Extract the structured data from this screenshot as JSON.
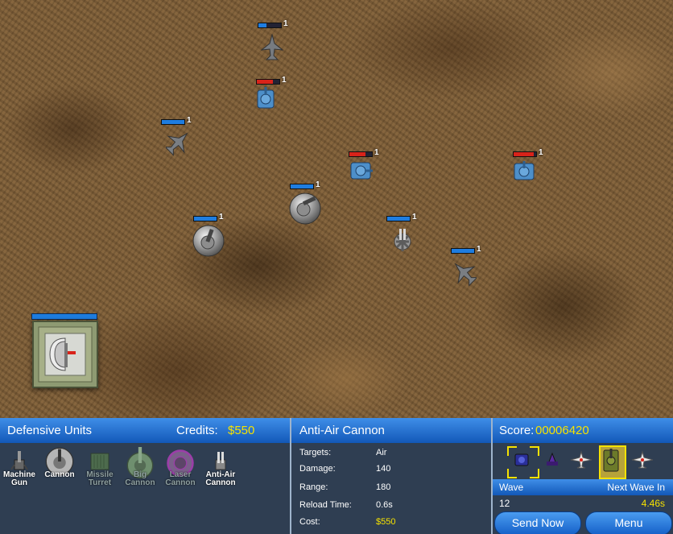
{
  "map": {
    "enemies": [
      {
        "kind": "jet",
        "hp_color": "blue",
        "hp": 0.35,
        "level": "1"
      },
      {
        "kind": "tank",
        "hp_color": "red",
        "hp": 0.7,
        "level": "1"
      },
      {
        "kind": "jet",
        "hp_color": "blue",
        "hp": 1.0,
        "level": "1"
      },
      {
        "kind": "tank",
        "hp_color": "red",
        "hp": 0.7,
        "level": "1"
      },
      {
        "kind": "tank",
        "hp_color": "red",
        "hp": 0.9,
        "level": "1"
      },
      {
        "kind": "jet",
        "hp_color": "blue",
        "hp": 1.0,
        "level": "1"
      }
    ],
    "towers": [
      {
        "kind": "cannon",
        "hp_color": "blue",
        "hp": 1.0,
        "level": "1"
      },
      {
        "kind": "cannon",
        "hp_color": "blue",
        "hp": 1.0,
        "level": "1"
      },
      {
        "kind": "anti-air",
        "hp_color": "blue",
        "hp": 1.0,
        "level": "1"
      }
    ],
    "base_hp": 1.0
  },
  "defensive_units": {
    "title": "Defensive Units",
    "credits_label": "Credits:",
    "credits_value": "$550",
    "units": [
      {
        "label": "Machine\nGun",
        "enabled": true
      },
      {
        "label": "Cannon",
        "enabled": true
      },
      {
        "label": "Missile\nTurret",
        "enabled": false
      },
      {
        "label": "Big\nCannon",
        "enabled": false
      },
      {
        "label": "Laser\nCannon",
        "enabled": false
      },
      {
        "label": "Anti-Air\nCannon",
        "enabled": true
      }
    ]
  },
  "selected_unit": {
    "title": "Anti-Air Cannon",
    "targets_label": "Targets:",
    "targets_value": "Air",
    "damage_label": "Damage:",
    "damage_value": "140",
    "range_label": "Range:",
    "range_value": "180",
    "reload_label": "Reload Time:",
    "reload_value": "0.6s",
    "cost_label": "Cost:",
    "cost_value": "$550"
  },
  "score": {
    "label": "Score:",
    "value": "00006420",
    "wave_label": "Wave",
    "wave_value": "12",
    "next_wave_label": "Next Wave In",
    "next_wave_value": "4.46s",
    "send_now_label": "Send Now",
    "menu_label": "Menu"
  },
  "colors": {
    "accent_yellow": "#f6e200",
    "hp_blue": "#1e7de0",
    "hp_red": "#d8231a",
    "panel": "#2f3e52"
  }
}
